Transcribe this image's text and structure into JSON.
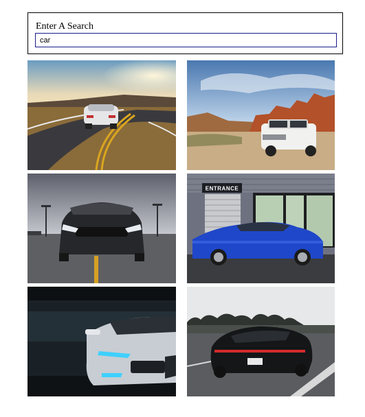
{
  "search": {
    "label": "Enter A Search",
    "value": "car"
  },
  "results": [
    {
      "name": "car-result-image-1",
      "subject": "white sports car on winding road at sunset"
    },
    {
      "name": "car-result-image-2",
      "subject": "white SUV in desert with red rocks"
    },
    {
      "name": "car-result-image-3",
      "subject": "dark Mustang on empty road front view"
    },
    {
      "name": "car-result-image-4",
      "subject": "blue coupe in front of building",
      "sign_text": "ENTRANCE"
    },
    {
      "name": "car-result-image-5",
      "subject": "silver Audi with blue lights in dark garage"
    },
    {
      "name": "car-result-image-6",
      "subject": "black Porsche on road rear view"
    }
  ]
}
